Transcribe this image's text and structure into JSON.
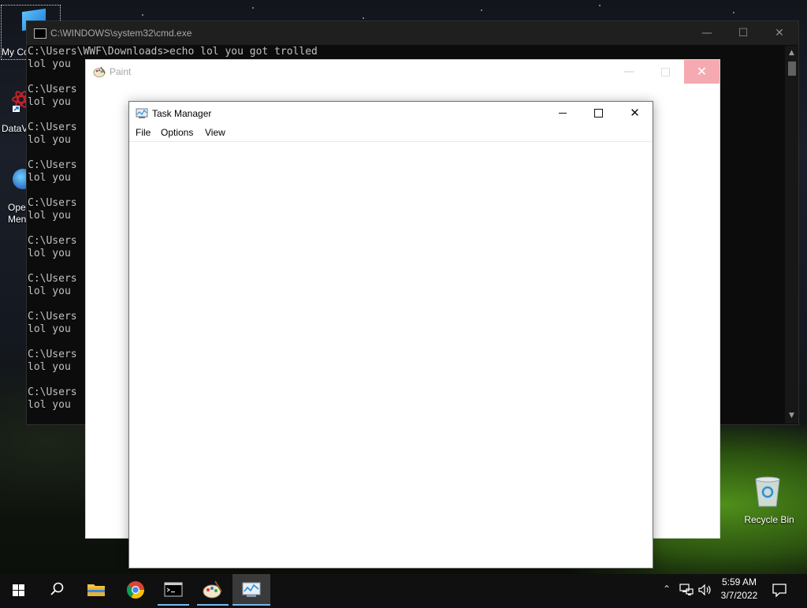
{
  "desktop": {
    "icons": [
      {
        "label": "My Co"
      },
      {
        "label": "DataV"
      },
      {
        "label_line1": "Ope",
        "label_line2": "Men"
      },
      {
        "label": "Recycle Bin"
      }
    ]
  },
  "cmd_window": {
    "title": "C:\\WINDOWS\\system32\\cmd.exe",
    "minimize_glyph": "—",
    "maximize_glyph": "☐",
    "close_glyph": "✕",
    "first_line": "C:\\Users\\WWF\\Downloads>echo lol you got trolled",
    "lines": [
      "lol you",
      "",
      "C:\\Users",
      "lol you",
      "",
      "C:\\Users",
      "lol you",
      "",
      "C:\\Users",
      "lol you",
      "",
      "C:\\Users",
      "lol you",
      "",
      "C:\\Users",
      "lol you",
      "",
      "C:\\Users",
      "lol you",
      "",
      "C:\\Users",
      "lol you",
      "",
      "C:\\Users",
      "lol you",
      "",
      "C:\\Users",
      "lol you"
    ]
  },
  "paint_window": {
    "title": "Paint",
    "minimize_glyph": "—",
    "close_glyph": "✕"
  },
  "task_manager": {
    "title": "Task Manager",
    "close_glyph": "✕",
    "menu": [
      "File",
      "Options",
      "View"
    ]
  },
  "taskbar": {
    "apps": [
      "start-icon",
      "search-icon",
      "file-explorer-icon",
      "chrome-icon",
      "cmd-icon",
      "paint-icon",
      "task-manager-icon"
    ],
    "active_app": "task-manager-icon",
    "clock": {
      "time": "5:59 AM",
      "date": "3/7/2022"
    },
    "tray_chevron_glyph": "⌃"
  },
  "colors": {
    "cmd_background": "#0c0c0c",
    "cmd_text": "#c0c0c0",
    "taskbar_background": "#101010",
    "taskbar_accent": "#76b9ed",
    "paint_close_hover": "#f5a9b0"
  }
}
